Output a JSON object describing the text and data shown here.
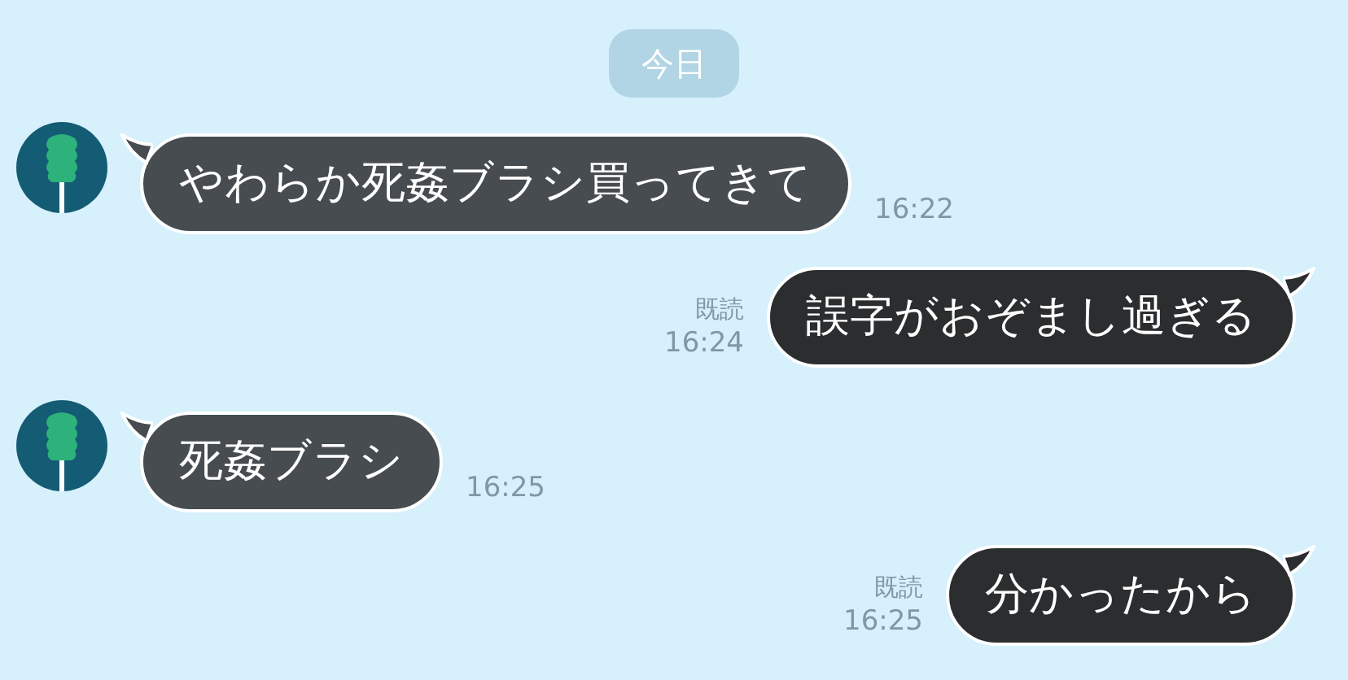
{
  "date_label": "今日",
  "messages": [
    {
      "kind": "received",
      "text": "やわらか死姦ブラシ買ってきて",
      "time": "16:22"
    },
    {
      "kind": "sent",
      "text": "誤字がおぞまし過ぎる",
      "read_label": "既読",
      "time": "16:24"
    },
    {
      "kind": "received",
      "text": "死姦ブラシ",
      "time": "16:25"
    },
    {
      "kind": "sent",
      "text": "分かったから",
      "read_label": "既読",
      "time": "16:25"
    }
  ]
}
